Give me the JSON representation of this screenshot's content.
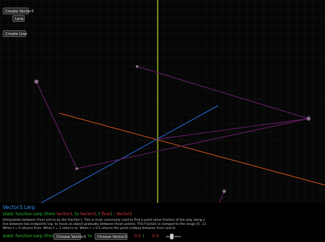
{
  "toolbar": {
    "create_vector3": "Create Vector3",
    "lerp": "Lerp",
    "create_line": "Create Line"
  },
  "doc": {
    "title": "Vector3.Lerp",
    "signature": {
      "static_function": "static function Lerp (from",
      "from_type": "Vector3",
      "to_keyword": ", to",
      "to_type": "Vector3",
      "t_keyword": ", t",
      "t_type": "float",
      "returns": "Vector3"
    },
    "description": "Interpolates between from and to by the fraction t. This is most commonly used to find a point some fraction of the way along a line between two endpoints (eg. to move an object gradually between those points). This fraction is clamped to the range [0...1]. When t = 0 returns from. When t = 1 returns to. When t = 0.5 returns the point midway between from and to."
  },
  "call": {
    "prefix": "static function Lerp (from",
    "choose_from": "Choose Vector3",
    "to_label": "to",
    "choose_to": "Choose Vector3",
    "t_value": "0.5",
    "close_paren": ")",
    "t_display": "0.5",
    "slider_value": 0.5
  },
  "colors": {
    "axis_x": "#e05a1e",
    "axis_y": "#c8e632",
    "axis_z": "#2a6ee8",
    "lines": "#5a1a5a",
    "points": "#8a6a8a",
    "doc_title": "#3a8eea",
    "keyword": "#32c832",
    "type": "#e03c3c"
  }
}
